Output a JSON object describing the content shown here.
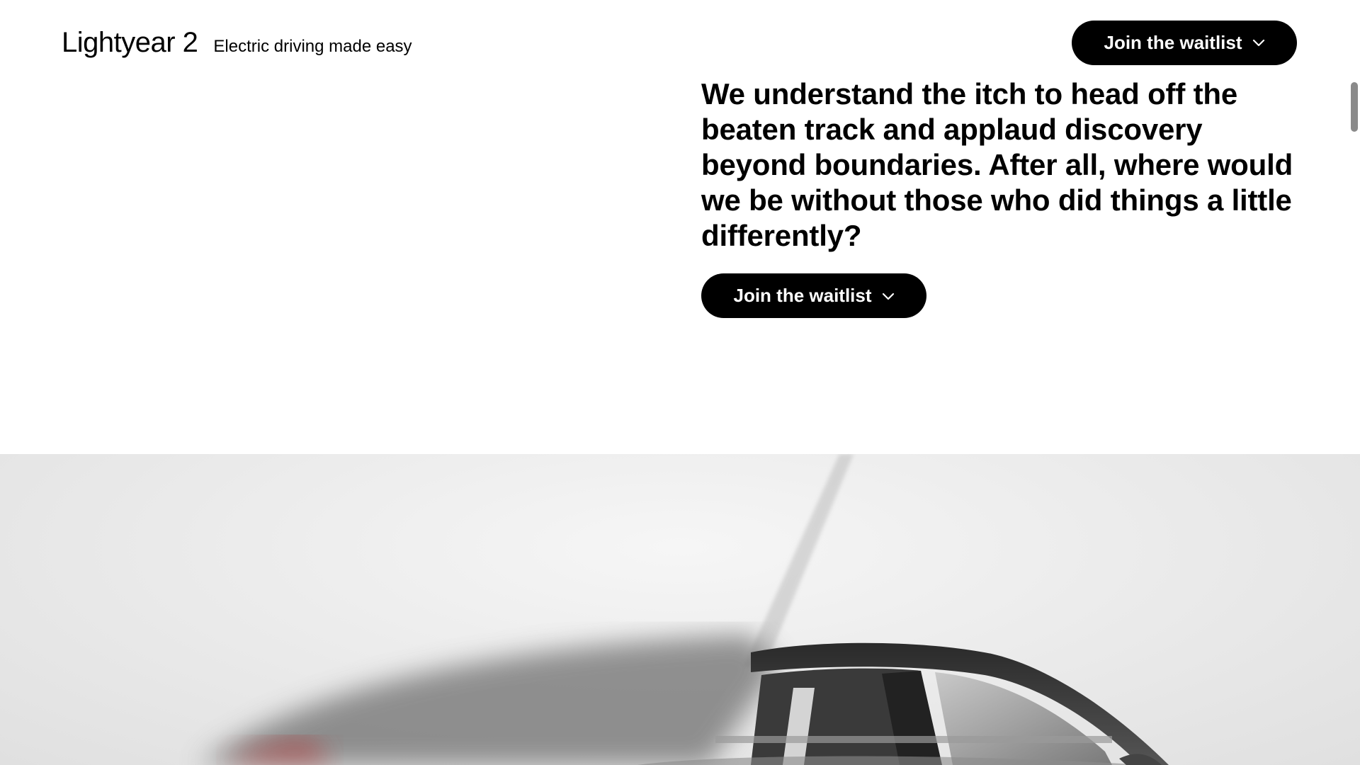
{
  "header": {
    "brand": "Lightyear 2",
    "tagline": "Electric driving made easy",
    "cta_label": "Join the waitlist"
  },
  "hero": {
    "text": "We understand the itch to head off the beaten track and applaud discovery beyond boundaries. After all, where would we be without those who did things a little differently?",
    "cta_label": "Join the waitlist"
  },
  "icons": {
    "cta_icon": "chevron-down-icon"
  },
  "colors": {
    "button_bg": "#000000",
    "button_text": "#ffffff",
    "page_bg": "#ffffff",
    "image_bg": "#ececec"
  }
}
